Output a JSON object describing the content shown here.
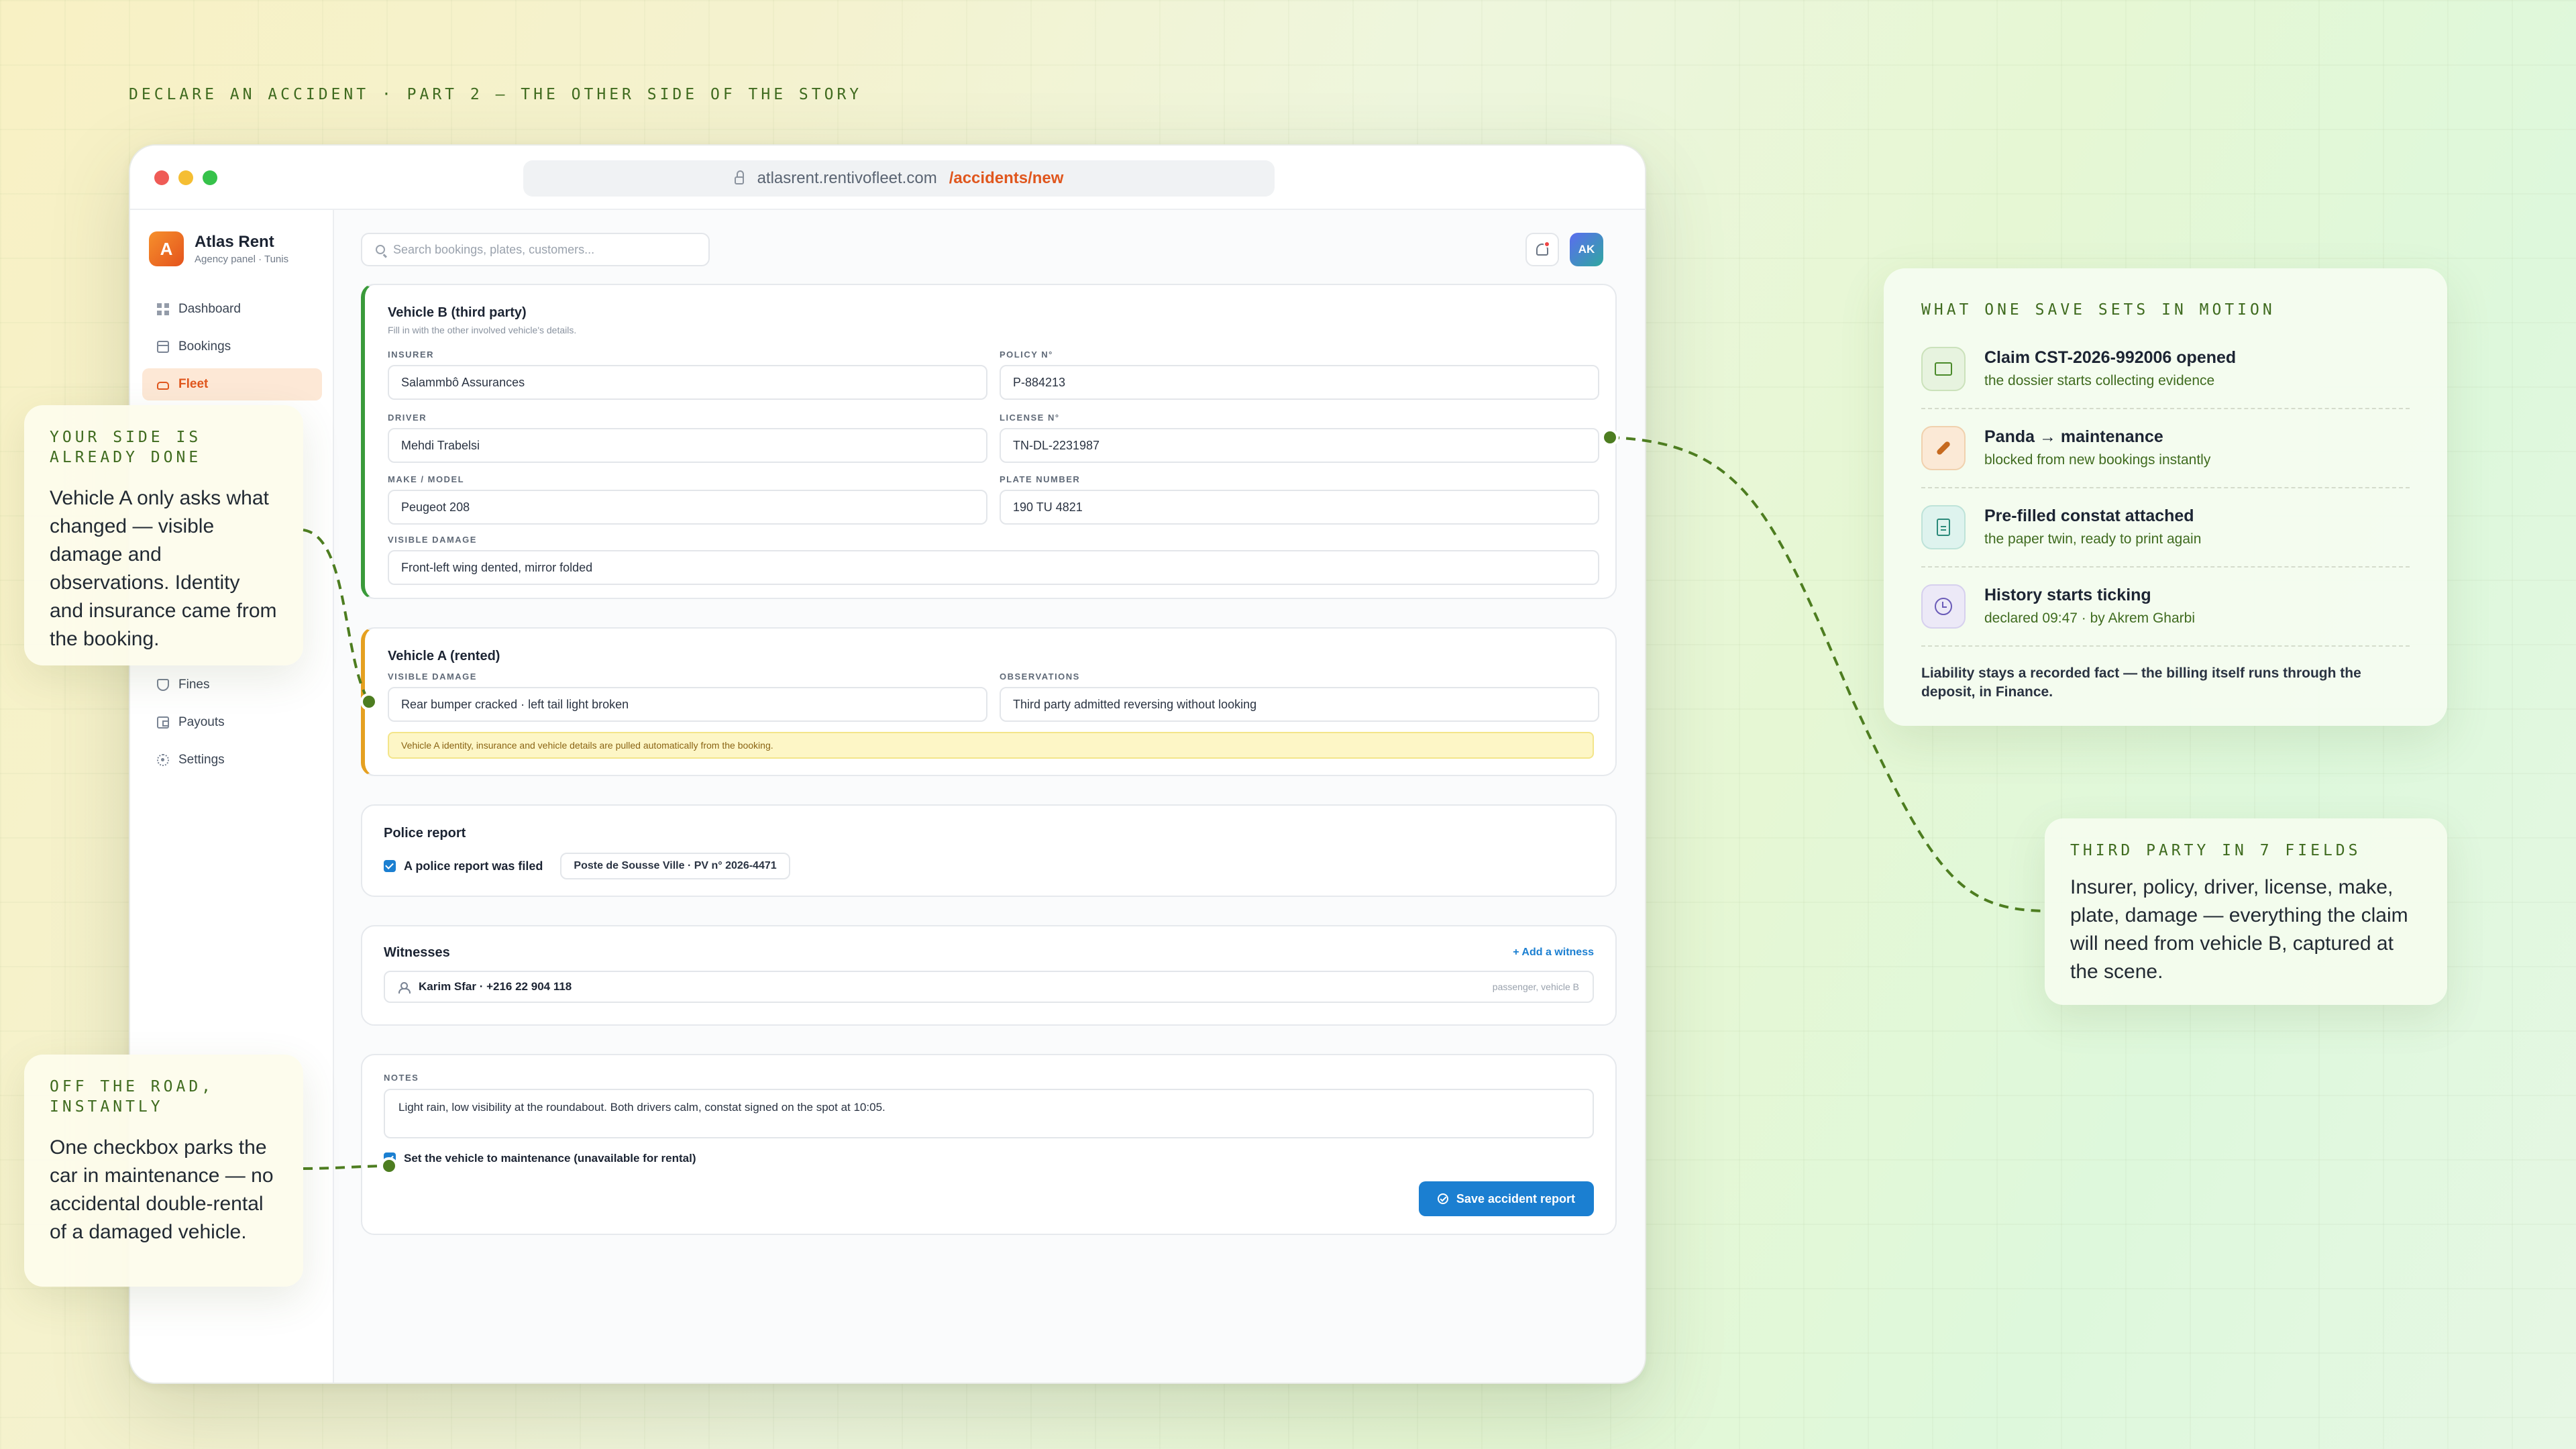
{
  "headline": "DECLARE AN ACCIDENT · PART 2 — THE OTHER SIDE OF THE STORY",
  "browser": {
    "url_host": "atlasrent.rentivofleet.com",
    "url_path": "/accidents/new"
  },
  "brand": {
    "logo_letter": "A",
    "name": "Atlas Rent",
    "subtitle": "Agency panel · Tunis"
  },
  "sidebar": {
    "items": [
      {
        "label": "Dashboard",
        "icon": "grid-icon"
      },
      {
        "label": "Bookings",
        "icon": "calendar-icon"
      },
      {
        "label": "Fleet",
        "icon": "car-icon",
        "active": true
      },
      {
        "label": "Fines",
        "icon": "shield-icon"
      },
      {
        "label": "Payouts",
        "icon": "wallet-icon"
      },
      {
        "label": "Settings",
        "icon": "gear-icon"
      }
    ]
  },
  "topbar": {
    "search_placeholder": "Search bookings, plates, customers...",
    "avatar_initials": "AK"
  },
  "vehicle_b": {
    "title": "Vehicle B (third party)",
    "subtitle": "Fill in with the other involved vehicle's details.",
    "insurer_label": "INSURER",
    "insurer_value": "Salammbô Assurances",
    "policy_label": "POLICY N°",
    "policy_value": "P-884213",
    "driver_label": "DRIVER",
    "driver_value": "Mehdi Trabelsi",
    "license_label": "LICENSE N°",
    "license_value": "TN-DL-2231987",
    "make_label": "MAKE / MODEL",
    "make_value": "Peugeot 208",
    "plate_label": "PLATE NUMBER",
    "plate_value": "190 TU 4821",
    "damage_label": "VISIBLE DAMAGE",
    "damage_value": "Front-left wing dented, mirror folded"
  },
  "vehicle_a": {
    "title": "Vehicle A (rented)",
    "damage_label": "VISIBLE DAMAGE",
    "damage_value": "Rear bumper cracked · left tail light broken",
    "observations_label": "OBSERVATIONS",
    "observations_value": "Third party admitted reversing without looking",
    "notice": "Vehicle A identity, insurance and vehicle details are pulled automatically from the booking."
  },
  "police": {
    "title": "Police report",
    "checkbox_label": "A police report was filed",
    "report_ref": "Poste de Sousse Ville · PV n° 2026-4471"
  },
  "witnesses": {
    "title": "Witnesses",
    "add_label": "+ Add a witness",
    "items": [
      {
        "name": "Karim Sfar · +216 22 904 118",
        "tag": "passenger, vehicle B"
      }
    ]
  },
  "notes": {
    "label": "NOTES",
    "value": "Light rain, low visibility at the roundabout. Both drivers calm, constat signed on the spot at 10:05.",
    "maintenance_label": "Set the vehicle to maintenance (unavailable for rental)",
    "save_label": "Save accident report"
  },
  "callouts": {
    "your_side_title": "YOUR SIDE IS ALREADY DONE",
    "your_side_body": "Vehicle A only asks what changed — visible damage and observations. Identity and insurance came from the booking.",
    "off_road_title": "OFF THE ROAD, INSTANTLY",
    "off_road_body": "One checkbox parks the car in maintenance — no accidental double-rental of a damaged vehicle.",
    "third_party_title": "THIRD PARTY IN 7 FIELDS",
    "third_party_body": "Insurer, policy, driver, license, make, plate, damage — everything the claim will need from vehicle B, captured at the scene."
  },
  "motion": {
    "title": "WHAT ONE SAVE SETS IN MOTION",
    "items": [
      {
        "title": "Claim CST-2026-992006 opened",
        "sub": "the dossier starts collecting evidence",
        "icon": "folder-icon"
      },
      {
        "title": "Panda → maintenance",
        "sub": "blocked from new bookings instantly",
        "icon": "wrench-icon"
      },
      {
        "title": "Pre-filled constat attached",
        "sub": "the paper twin, ready to print again",
        "icon": "document-icon"
      },
      {
        "title": "History starts ticking",
        "sub": "declared 09:47 · by Akrem Gharbi",
        "icon": "clock-icon"
      }
    ],
    "footer": "Liability stays a recorded fact — the billing itself runs through the deposit, in Finance."
  },
  "colors": {
    "accent_orange": "#e0571e",
    "primary_blue": "#1b7fd1",
    "vehicle_b_accent": "#3a9a3a",
    "vehicle_a_accent": "#e5a020",
    "annotation_green": "#3f6b1f"
  }
}
